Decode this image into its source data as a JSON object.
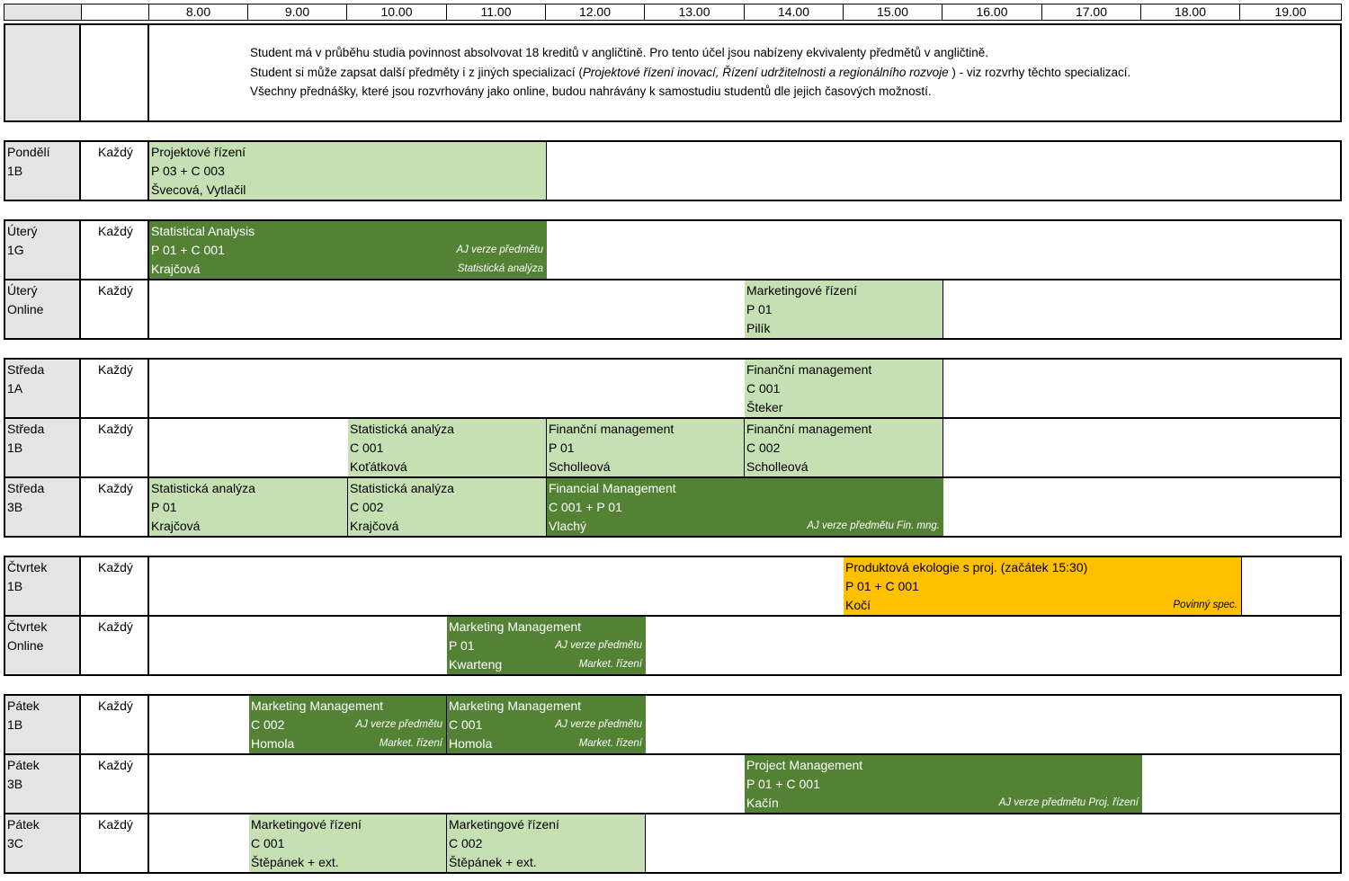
{
  "header": {
    "hours": [
      "8.00",
      "9.00",
      "10.00",
      "11.00",
      "12.00",
      "13.00",
      "14.00",
      "15.00",
      "16.00",
      "17.00",
      "18.00",
      "19.00"
    ]
  },
  "notes": {
    "line1": "Student má v průběhu studia povinnost absolvovat 18 kreditů v angličtině. Pro tento účel jsou nabízeny ekvivalenty předmětů v angličtině.",
    "line2_prefix": "Student si může zapsat další předměty i z jiných specializací (",
    "line2_italic": "Projektové řízení inovací, Řízení udržitelnosti a regionálního rozvoje",
    "line2_suffix": " ) - viz rozvrhy těchto specializací.",
    "line3": "Všechny přednášky, které jsou rozvrhovány jako online, budou nahrávány k samostudiu studentů dle jejich časových možností."
  },
  "week_label": "Každý",
  "days": {
    "monday": {
      "r1": {
        "day": "Pondělí",
        "group": "1B",
        "b1": {
          "title": "Projektové řízení",
          "room": "P 03 + C 003",
          "teacher": "Švecová, Vytlačil"
        }
      }
    },
    "tuesday": {
      "r1": {
        "day": "Úterý",
        "group": "1G",
        "b1": {
          "title": "Statistical Analysis",
          "room": "P 01 + C 001",
          "teacher": "Krajčová",
          "note1": "AJ verze předmětu",
          "note2": "Statistická analýza"
        }
      },
      "r2": {
        "day": "Úterý",
        "group": "Online",
        "b1": {
          "title": "Marketingové řízení",
          "room": "P 01",
          "teacher": "Pilík"
        }
      }
    },
    "wednesday": {
      "r1": {
        "day": "Středa",
        "group": "1A",
        "b1": {
          "title": "Finanční management",
          "room": "C 001",
          "teacher": "Šteker"
        }
      },
      "r2": {
        "day": "Středa",
        "group": "1B",
        "b1": {
          "title": "Statistická analýza",
          "room": "C 001",
          "teacher": "Koťátková"
        },
        "b2": {
          "title": "Finanční management",
          "room": "P 01",
          "teacher": "Scholleová"
        },
        "b3": {
          "title": "Finanční management",
          "room": "C 002",
          "teacher": "Scholleová"
        }
      },
      "r3": {
        "day": "Středa",
        "group": "3B",
        "b1": {
          "title": "Statistická analýza",
          "room": "P 01",
          "teacher": "Krajčová"
        },
        "b2": {
          "title": "Statistická analýza",
          "room": "C 002",
          "teacher": "Krajčová"
        },
        "b3": {
          "title": "Financial Management",
          "room": "C 001 + P 01",
          "teacher": "Vlachý",
          "note2": "AJ verze předmětu Fin. mng."
        }
      }
    },
    "thursday": {
      "r1": {
        "day": "Čtvrtek",
        "group": "1B",
        "b1": {
          "title": "Produktová ekologie s proj. (začátek 15:30)",
          "room": "P 01 + C 001",
          "teacher": "Kočí",
          "note2": "Povinný spec."
        }
      },
      "r2": {
        "day": "Čtvrtek",
        "group": "Online",
        "b1": {
          "title": "Marketing Management",
          "room": "P 01",
          "teacher": "Kwarteng",
          "note1": "AJ verze předmětu",
          "note2": "Market. řízení"
        }
      }
    },
    "friday": {
      "r1": {
        "day": "Pátek",
        "group": "1B",
        "b1": {
          "title": "Marketing Management",
          "room": "C 002",
          "teacher": "Homola",
          "note1": "AJ verze předmětu",
          "note2": "Market. řízení"
        },
        "b2": {
          "title": "Marketing Management",
          "room": "C 001",
          "teacher": "Homola",
          "note1": "AJ verze předmětu",
          "note2": "Market. řízení"
        }
      },
      "r2": {
        "day": "Pátek",
        "group": "3B",
        "b1": {
          "title": "Project Management",
          "room": "P 01 + C 001",
          "teacher": "Kačín",
          "note2": "AJ verze předmětu Proj. řízení"
        }
      },
      "r3": {
        "day": "Pátek",
        "group": "3C",
        "b1": {
          "title": "Marketingové řízení",
          "room": "C 001",
          "teacher": "Štěpánek + ext."
        },
        "b2": {
          "title": "Marketingové řízení",
          "room": "C 002",
          "teacher": "Štěpánek + ext."
        }
      }
    }
  },
  "colors": {
    "czech_course": "#c6e0b4",
    "english_course": "#548235",
    "mandatory_specialization": "#ffc000",
    "label_column": "#e4e4e4"
  }
}
